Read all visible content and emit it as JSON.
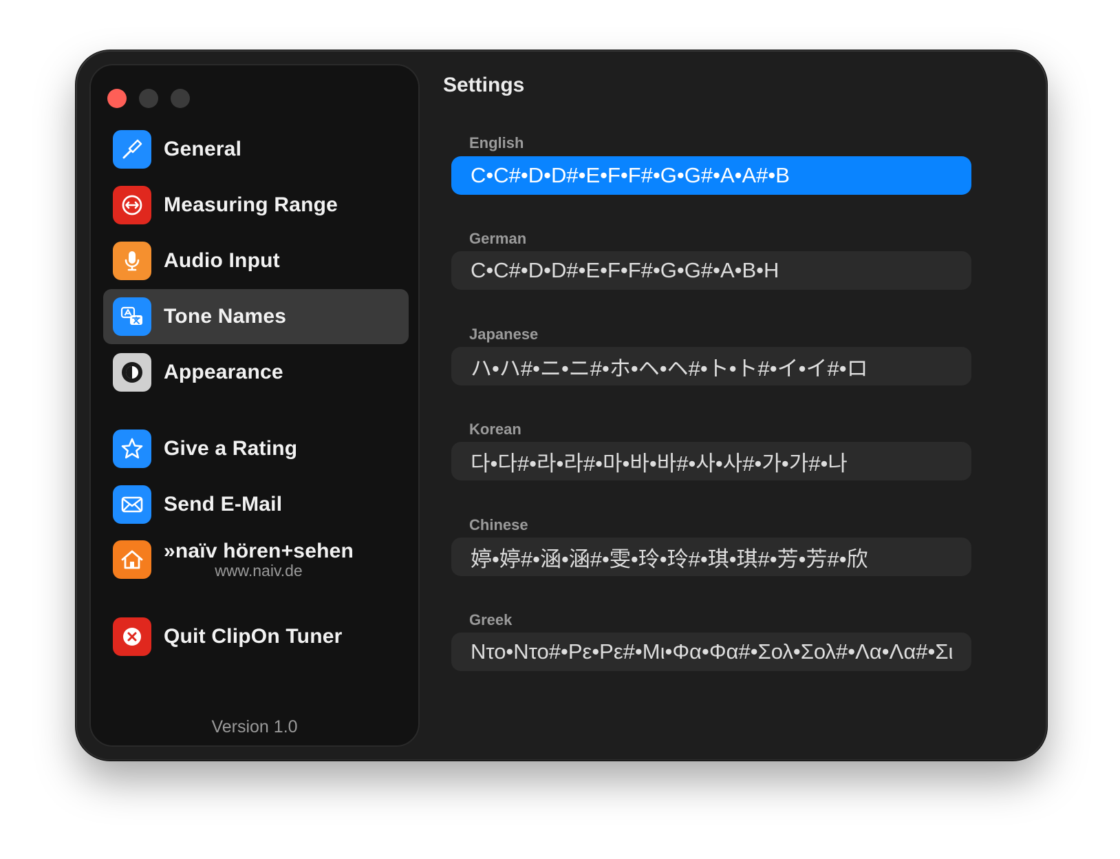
{
  "window": {
    "title": "Settings"
  },
  "sidebar": {
    "items": [
      {
        "label": "General",
        "icon": "tuning-fork-icon",
        "color": "#1e8cff"
      },
      {
        "label": "Measuring Range",
        "icon": "range-arrows-icon",
        "color": "#e0281e"
      },
      {
        "label": "Audio Input",
        "icon": "microphone-icon",
        "color": "#f5902f"
      },
      {
        "label": "Tone Names",
        "icon": "translate-icon",
        "color": "#1e8cff",
        "active": true
      },
      {
        "label": "Appearance",
        "icon": "contrast-icon",
        "color": "#d0d0d0"
      },
      {
        "label": "Give a Rating",
        "icon": "star-icon",
        "color": "#1e8cff"
      },
      {
        "label": "Send E-Mail",
        "icon": "envelope-icon",
        "color": "#1e8cff"
      },
      {
        "label": "»naïv hören+sehen",
        "sublabel": "www.naiv.de",
        "icon": "house-icon",
        "color": "#f57d1e"
      },
      {
        "label": "Quit ClipOn Tuner",
        "icon": "close-x-icon",
        "color": "#e0281e"
      }
    ],
    "version": "Version 1.0"
  },
  "tone_names": [
    {
      "language": "English",
      "value": "C•C#•D•D#•E•F•F#•G•G#•A•A#•B",
      "selected": true
    },
    {
      "language": "German",
      "value": "C•C#•D•D#•E•F•F#•G•G#•A•B•H"
    },
    {
      "language": "Japanese",
      "value": "ハ•ハ#•ニ•ニ#•ホ•ヘ•ヘ#•ト•ト#•イ•イ#•ロ"
    },
    {
      "language": "Korean",
      "value": "다•다#•라•라#•마•바•바#•사•사#•가•가#•나"
    },
    {
      "language": "Chinese",
      "value": "婷•婷#•涵•涵#•雯•玲•玲#•琪•琪#•芳•芳#•欣"
    },
    {
      "language": "Greek",
      "value": "Ντο•Ντο#•Ρε•Ρε#•Μι•Φα•Φα#•Σολ•Σολ#•Λα•Λα#•Σι"
    }
  ],
  "colors": {
    "accent": "#0a84ff",
    "window_bg": "#1e1e1e",
    "sidebar_bg": "#121212"
  }
}
